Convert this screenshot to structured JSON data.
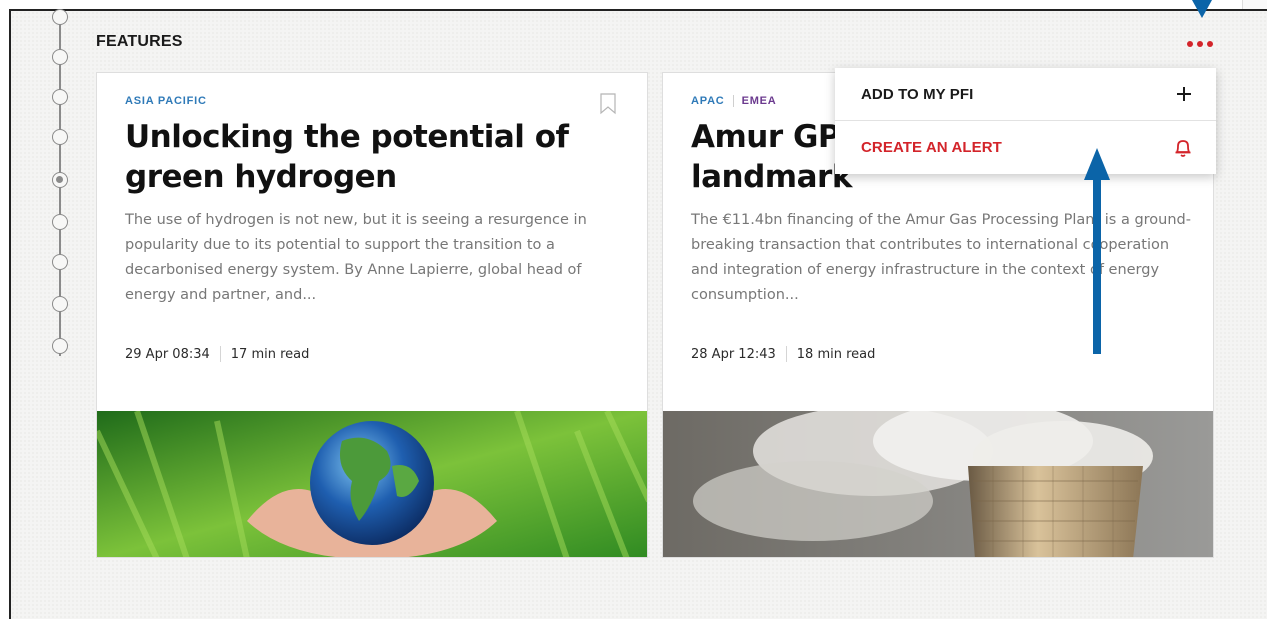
{
  "section": {
    "title": "FEATURES"
  },
  "timeline": {
    "node_count": 9,
    "active_index": 4
  },
  "menu": {
    "items": [
      {
        "label": "ADD TO MY PFI",
        "icon": "plus-icon"
      },
      {
        "label": "CREATE AN ALERT",
        "icon": "bell-icon"
      }
    ]
  },
  "cards": [
    {
      "tags": [
        "ASIA PACIFIC"
      ],
      "title": "Unlocking the potential of green hydrogen",
      "description": "The use of hydrogen is not new, but it is seeing a resurgence in popularity due to its potential to support the transition to a decarbonised energy system. By Anne Lapierre, global head of energy and partner, and...",
      "date": "29 Apr 08:34",
      "read_time": "17 min read",
      "image": "hands-holding-earth-image"
    },
    {
      "tags": [
        "APAC",
        "EMEA"
      ],
      "title": "Amur GPP landmark",
      "title_visible": [
        "Amur GP",
        "landmark"
      ],
      "description": "The €11.4bn financing of the Amur Gas Processing Plant is a ground-breaking transaction that contributes to international cooperation and integration of energy infrastructure in the context of energy consumption...",
      "date": "28 Apr 12:43",
      "read_time": "18 min read",
      "image": "cooling-tower-image"
    }
  ],
  "colors": {
    "accent_red": "#d3242a",
    "tag_blue": "#2f7ab8",
    "tag_purple": "#6b3a8f",
    "annotation_blue": "#0b64a8"
  }
}
